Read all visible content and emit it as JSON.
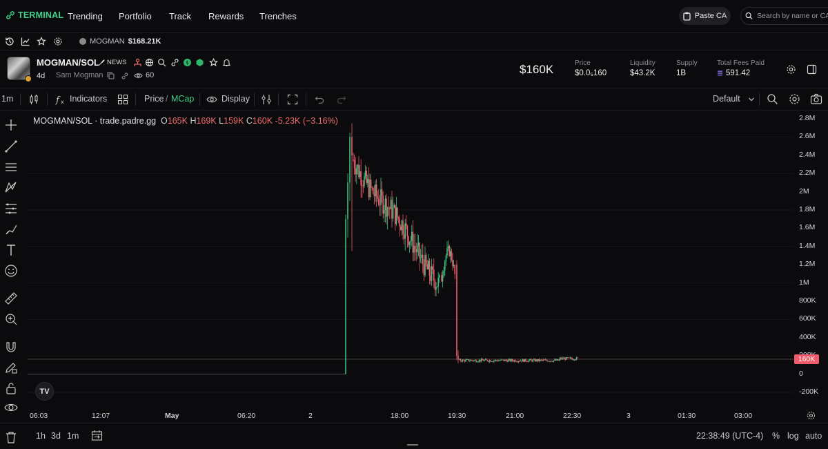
{
  "nav": {
    "logo": "TERMINAL",
    "items": [
      "Trending",
      "Portfolio",
      "Track",
      "Rewards",
      "Trenches"
    ],
    "paste_label": "Paste CA",
    "search_placeholder": "Search by name or CA..."
  },
  "subbar": {
    "ticker_name": "MOGMAN",
    "ticker_value": "$168.21K"
  },
  "token": {
    "pair": "MOGMAN/SOL",
    "news": "NEWS",
    "age": "4d",
    "creator": "Sam Mogman",
    "views": "60",
    "market_cap": "$160K",
    "stats": [
      {
        "label": "Price",
        "value": "$0.0₅160"
      },
      {
        "label": "Liquidity",
        "value": "$43.2K"
      },
      {
        "label": "Supply",
        "value": "1B"
      },
      {
        "label": "Total Fees Paid",
        "value": "591.42"
      }
    ]
  },
  "chart_toolbar": {
    "interval": "1m",
    "indicators": "Indicators",
    "price": "Price",
    "slash": "/",
    "mcap": "MCap",
    "display": "Display",
    "layout": "Default"
  },
  "legend": {
    "title": "MOGMAN/SOL · trade.padre.gg",
    "o_label": "O",
    "o": "165K",
    "h_label": "H",
    "h": "169K",
    "l_label": "L",
    "l": "159K",
    "c_label": "C",
    "c": "160K",
    "change": "-5.23K (−3.16%)"
  },
  "chart_data": {
    "type": "candlestick",
    "y_ticks": [
      "2.8M",
      "2.6M",
      "2.4M",
      "2.2M",
      "2M",
      "1.8M",
      "1.6M",
      "1.4M",
      "1.2M",
      "1M",
      "800K",
      "600K",
      "400K",
      "200K",
      "0",
      "-200K"
    ],
    "x_ticks": [
      "06:03",
      "12:07",
      "May",
      "06:20",
      "2",
      "18:00",
      "19:30",
      "21:00",
      "22:30",
      "3",
      "01:30",
      "03:00"
    ],
    "ylim": [
      -200000,
      2800000
    ],
    "current_value_label": "160K",
    "segments": [
      {
        "phase": "pre-launch flat",
        "value": 0
      },
      {
        "phase": "launch spike",
        "peak": 2750000
      },
      {
        "phase": "decline",
        "from": 2500000,
        "to": 950000
      },
      {
        "phase": "bounce",
        "peak": 1400000
      },
      {
        "phase": "crash",
        "to": 160000
      },
      {
        "phase": "consolidation",
        "value": 160000
      }
    ]
  },
  "bottom": {
    "ranges": [
      "1h",
      "3d",
      "1m"
    ],
    "clock": "22:38:49 (UTC-4)",
    "pct": "%",
    "log": "log",
    "auto": "auto"
  },
  "colors": {
    "up": "#3fbf7f",
    "down": "#ef5b6a",
    "accent": "#3fd08a"
  }
}
